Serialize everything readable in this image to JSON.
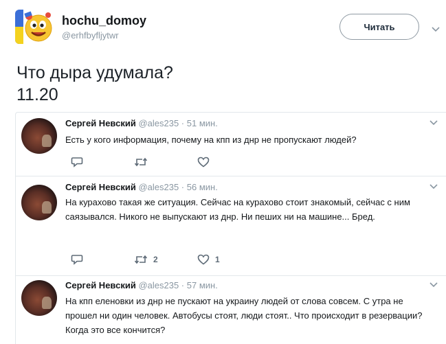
{
  "author": {
    "display_name": "hochu_domoy",
    "handle": "@erhfbyfljytwr",
    "follow_label": "Читать"
  },
  "tweet": {
    "line1": "Что дыра удумала?",
    "line2": "11.20"
  },
  "replies": [
    {
      "name": "Сергей Невский",
      "meta": "@ales235 · 51 мин.",
      "text": "Есть у кого информация,  почему на кпп из днр не пропускают людей?",
      "retweets": "",
      "likes": ""
    },
    {
      "name": "Сергей Невский",
      "meta": "@ales235 · 56 мин.",
      "text": "На курахово такая же ситуация.  Сейчас на курахово стоит знакомый,  сейчас с ним саязывался.  Никого не выпускают из днр.  Ни пеших ни на машине... Бред.",
      "retweets": "2",
      "likes": "1"
    },
    {
      "name": "Сергей Невский",
      "meta": "@ales235 · 57 мин.",
      "text": "На кпп еленовки из днр не пускают на украину людей от слова совсем.  С утра не прошел ни один человек.  Автобусы стоят,  люди стоят.. Что происходит в резервации?  Когда это все кончится?",
      "retweets": "",
      "likes": ""
    }
  ],
  "colors": {
    "text": "#14171a",
    "muted": "#8a97a2",
    "border": "#e2e7eb",
    "icon": "#5e6b77"
  },
  "icons": [
    "caret-down-icon",
    "reply-icon",
    "retweet-icon",
    "like-icon",
    "avatar-emoji"
  ]
}
